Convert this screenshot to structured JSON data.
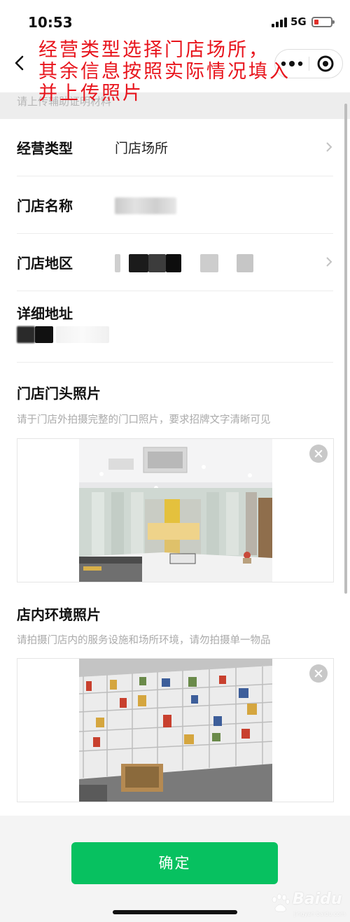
{
  "status_bar": {
    "time": "10:53",
    "network": "5G"
  },
  "annotation": {
    "lines": [
      "经营类型选择门店场所，",
      "其余信息按照实际情况填入",
      "并上传照片"
    ],
    "color": "#e8141c"
  },
  "page": {
    "hint_top": "请上传辅助证明材料"
  },
  "form": {
    "business_type": {
      "label": "经营类型",
      "value": "门店场所"
    },
    "store_name": {
      "label": "门店名称"
    },
    "store_region": {
      "label": "门店地区"
    },
    "detail_address": {
      "label": "详细地址"
    }
  },
  "storefront_photo": {
    "title": "门店门头照片",
    "hint": "请于门店外拍摄完整的门口照片，要求招牌文字清晰可见"
  },
  "interior_photo": {
    "title": "店内环境照片",
    "hint": "请拍摄门店内的服务设施和场所环境，请勿拍摄单一物品"
  },
  "footer": {
    "confirm_label": "确定",
    "accent_color": "#07c160"
  },
  "watermark": {
    "brand": "Baidu",
    "sub": "jingyan.baidu.com"
  }
}
